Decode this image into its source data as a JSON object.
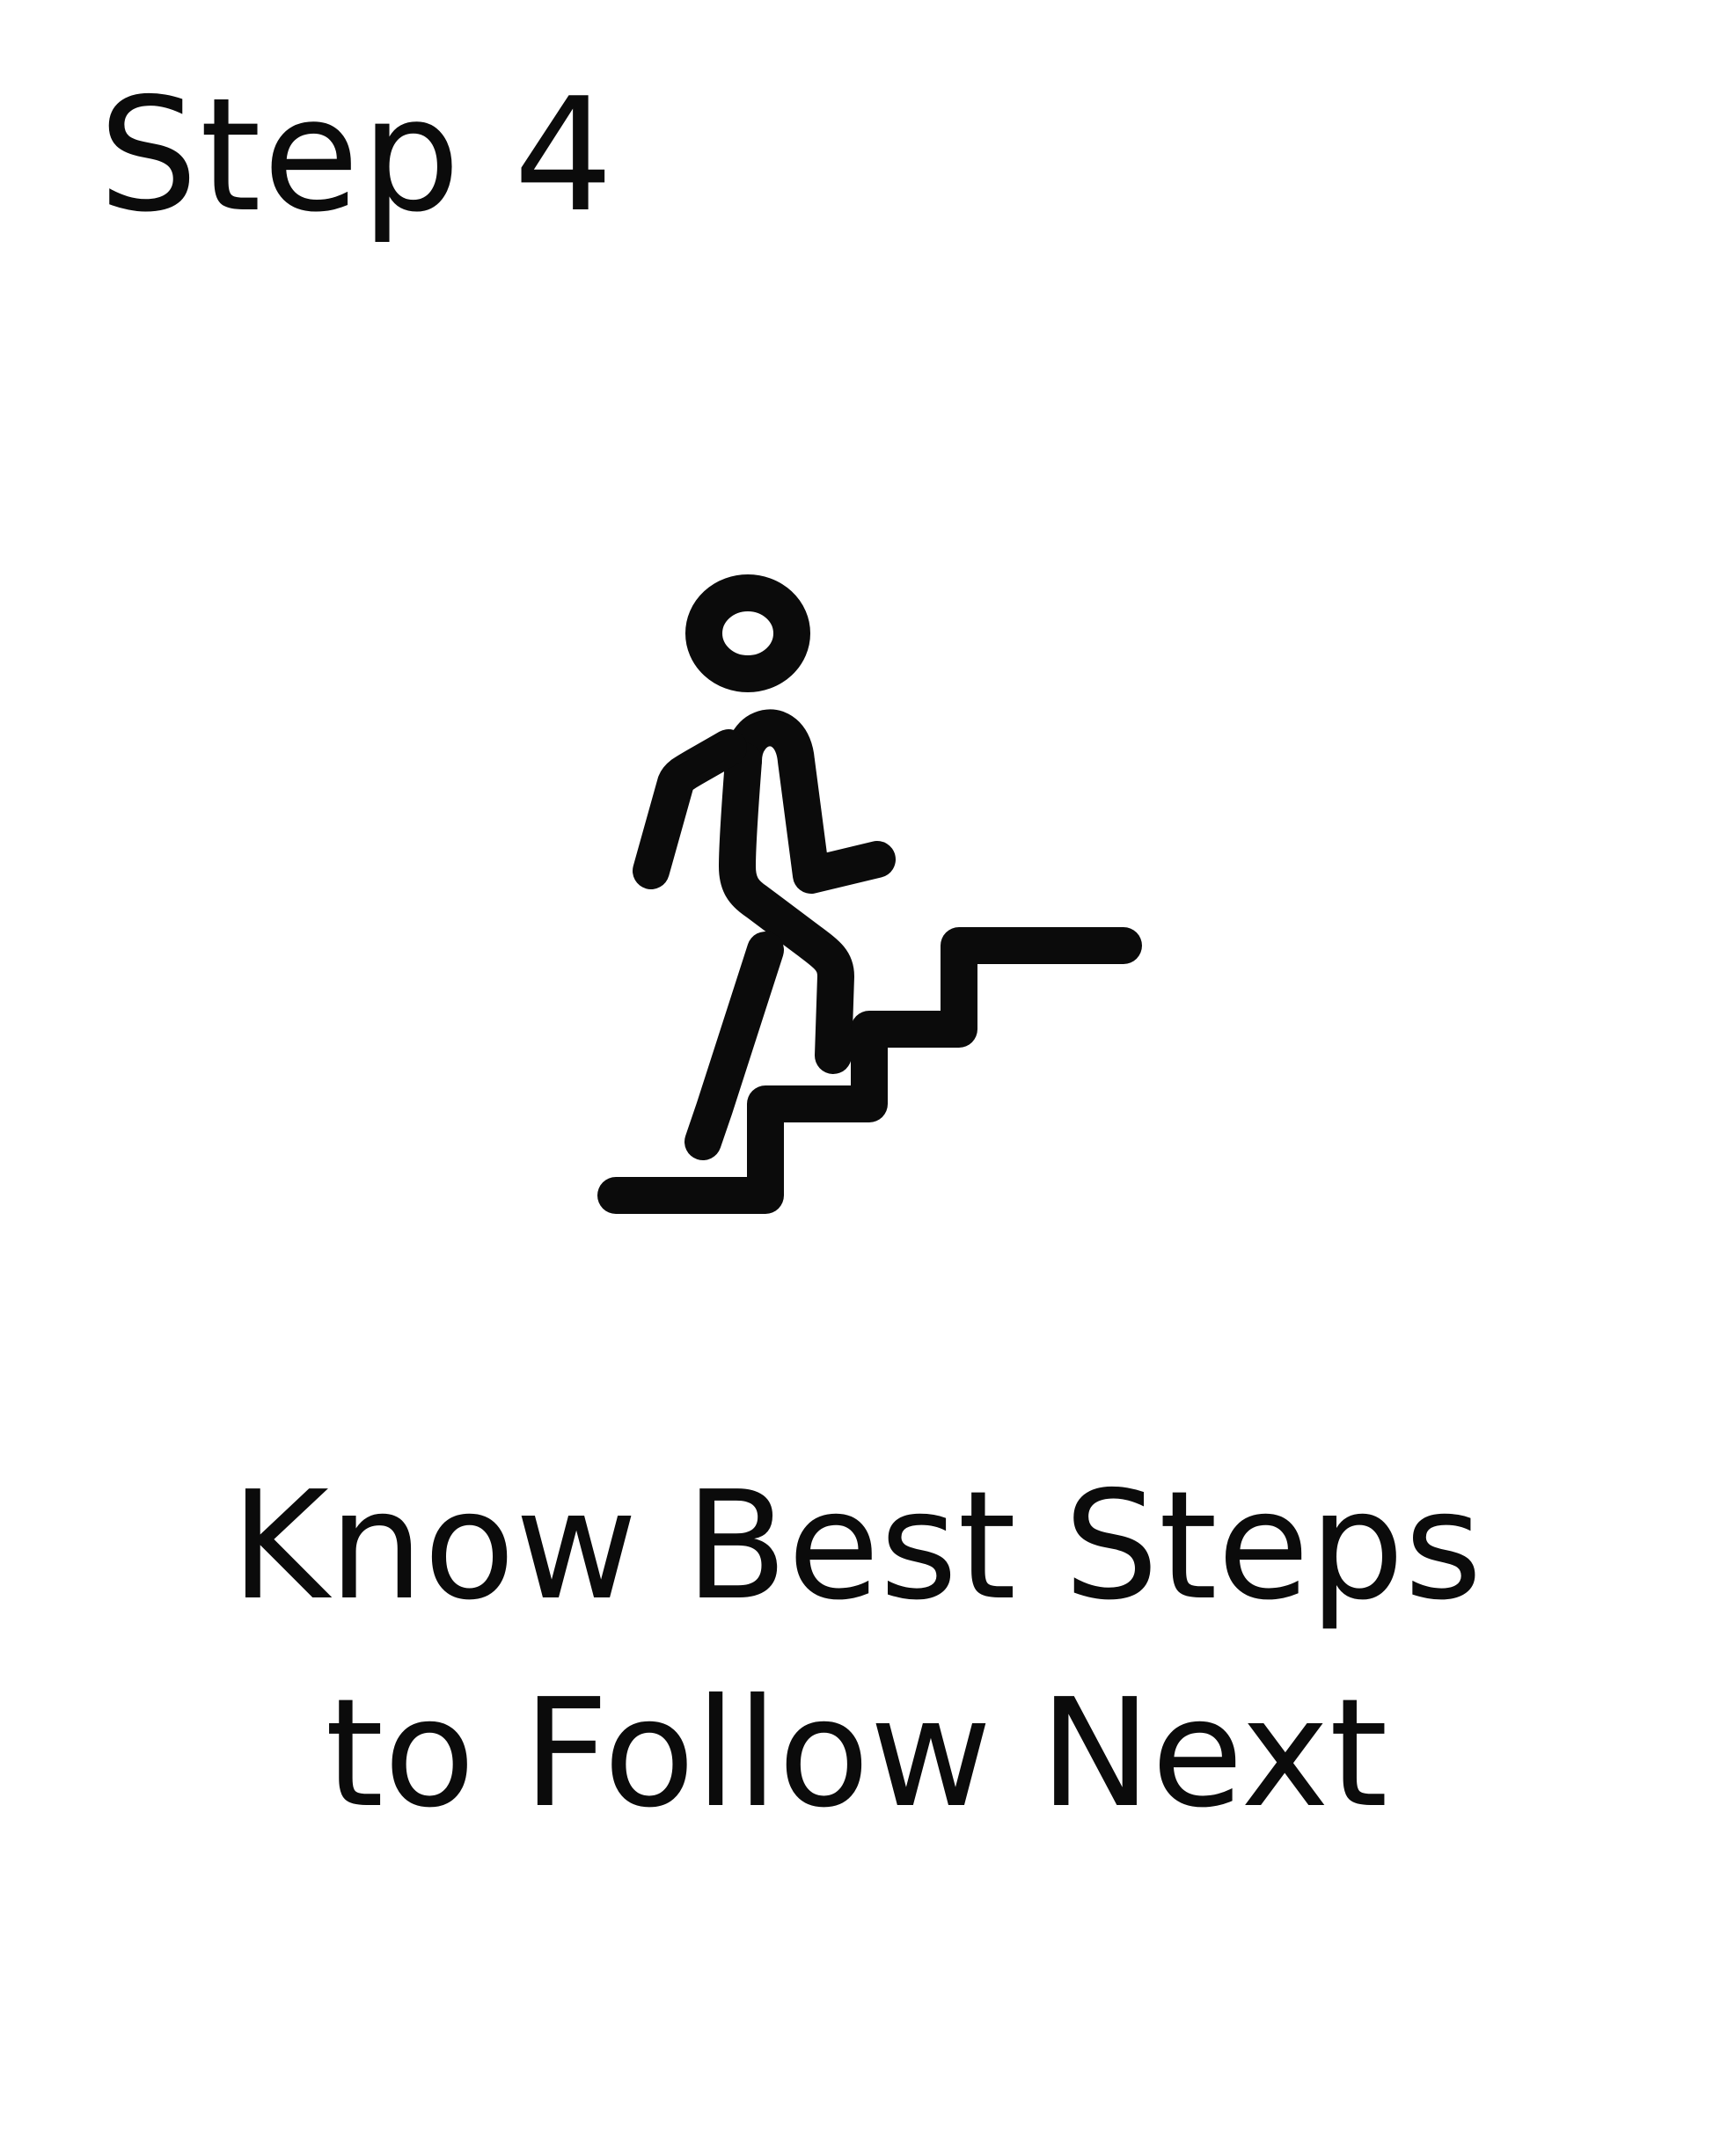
{
  "step": {
    "label": "Step 4"
  },
  "illustration": {
    "icon": "person-climbing-stairs-icon",
    "stroke_color": "#0b0b0b"
  },
  "headline": {
    "line1": "Know Best Steps",
    "line2": "to Follow Next"
  },
  "colors": {
    "background": "#ffffff",
    "text": "#0b0b0b"
  }
}
